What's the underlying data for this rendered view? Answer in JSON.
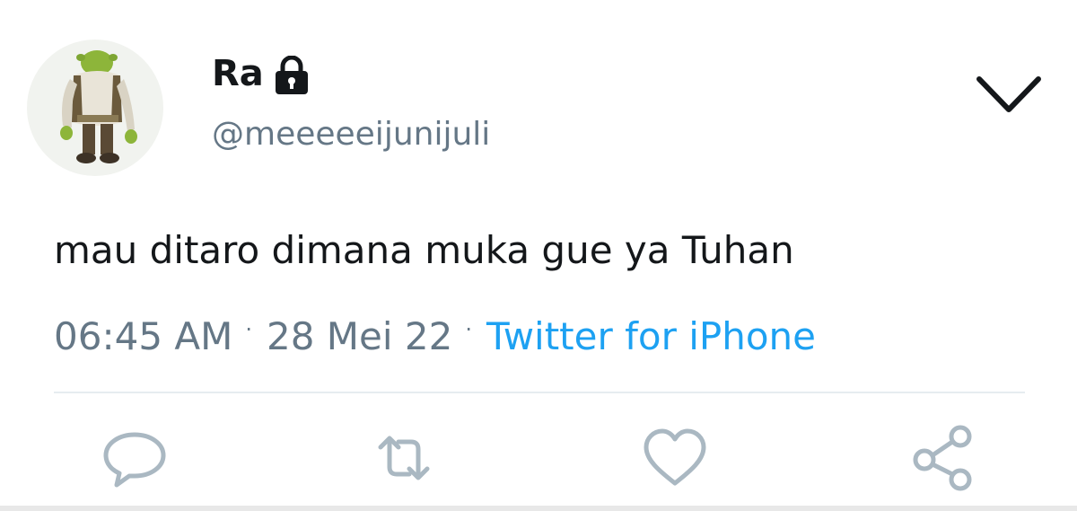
{
  "user": {
    "display_name": "Ra",
    "handle": "@meeeeeijunijuli",
    "avatar_icon": "shrek-avatar",
    "protected_icon": "lock-icon"
  },
  "tweet": {
    "text": "mau ditaro dimana muka gue ya Tuhan",
    "time": "06:45 AM",
    "date": "28 Mei 22",
    "separator": "·",
    "source": "Twitter for iPhone"
  },
  "actions": {
    "reply_icon": "reply-icon",
    "retweet_icon": "retweet-icon",
    "like_icon": "like-icon",
    "share_icon": "share-icon"
  },
  "colors": {
    "text": "#14171a",
    "secondary": "#657786",
    "link": "#1da1f2",
    "icon": "#aab8c2",
    "divider": "#e6ecf0"
  }
}
